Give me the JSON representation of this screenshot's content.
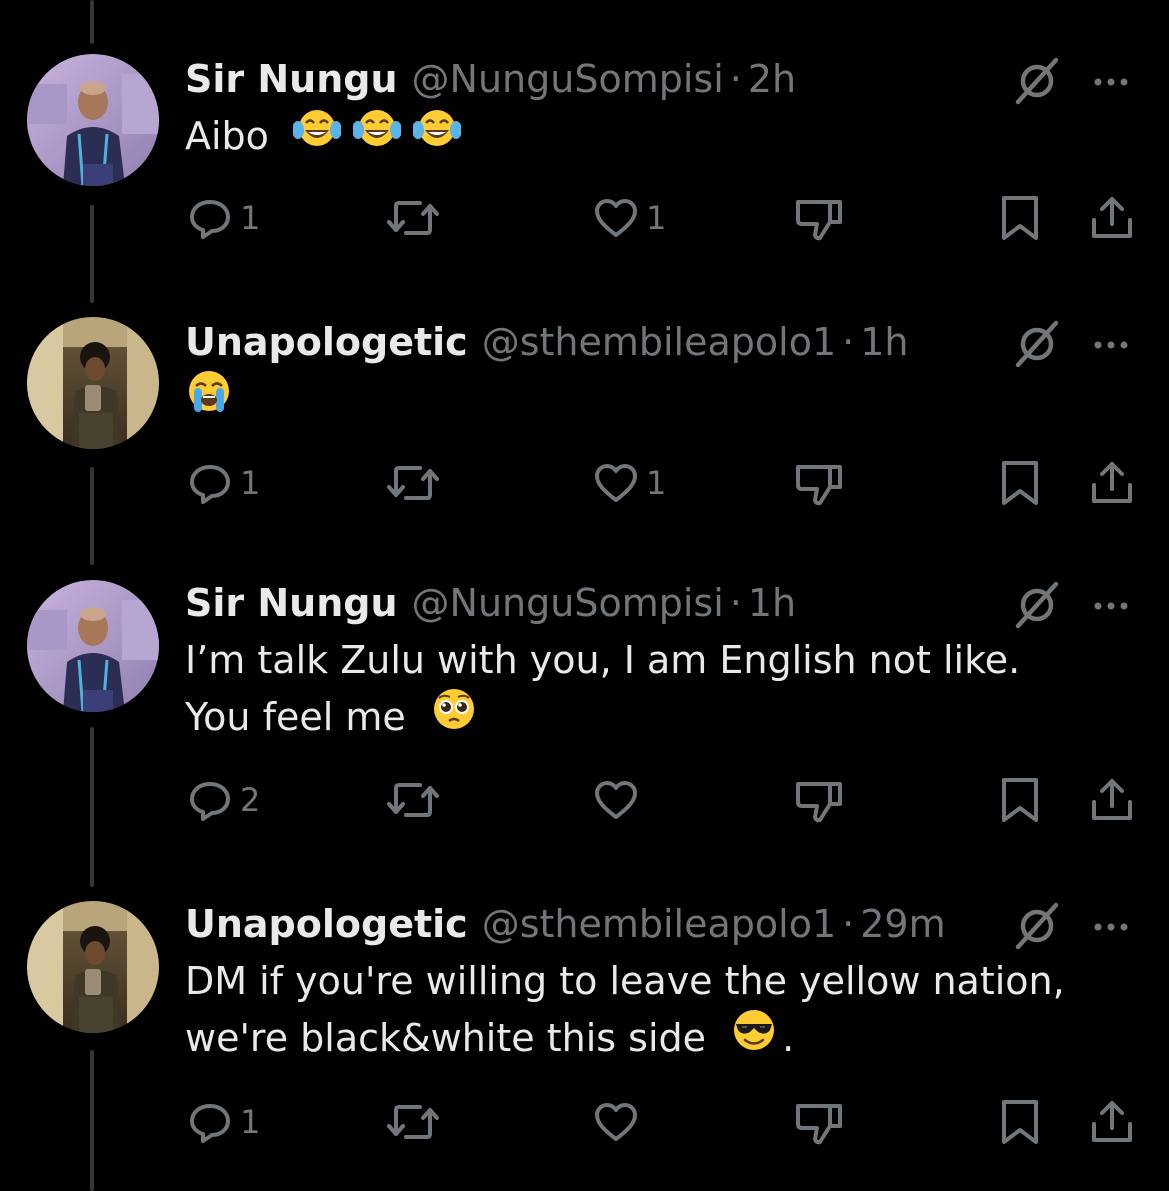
{
  "tweets": [
    {
      "name": "Sir Nungu",
      "handle": "@NunguSompisi",
      "separator": "·",
      "time": "2h",
      "lines": [
        "Aibo",
        ""
      ],
      "emojis": [
        "laughing-tears",
        "laughing-tears",
        "laughing-tears"
      ],
      "replies": "1",
      "reposts": "",
      "likes": "1"
    },
    {
      "name": "Unapologetic",
      "handle": "@sthembileapolo1",
      "separator": "·",
      "time": "1h",
      "lines": [
        "",
        ""
      ],
      "emojis": [
        "loudly-crying"
      ],
      "replies": "1",
      "reposts": "",
      "likes": "1"
    },
    {
      "name": "Sir Nungu",
      "handle": "@NunguSompisi",
      "separator": "·",
      "time": "1h",
      "lines": [
        "I’m talk Zulu with you, I am English not like.",
        "You feel me"
      ],
      "emojis": [
        "pleading-face"
      ],
      "replies": "2",
      "reposts": "",
      "likes": ""
    },
    {
      "name": "Unapologetic",
      "handle": "@sthembileapolo1",
      "separator": "·",
      "time": "29m",
      "lines": [
        "DM if you're willing to leave the yellow nation,",
        "we're black&white this side"
      ],
      "line2_suffix": ".",
      "emojis": [
        "sunglasses-face"
      ],
      "replies": "1",
      "reposts": "",
      "likes": ""
    }
  ],
  "icons": {
    "reply": "reply-icon",
    "repost": "repost-icon",
    "like": "heart-icon",
    "downvote": "downvote-icon",
    "bookmark": "bookmark-icon",
    "share": "share-icon",
    "grok": "grok-icon",
    "more": "more-icon"
  },
  "colors": {
    "background": "#000000",
    "text_primary": "#e7e9ea",
    "text_secondary": "#71767b",
    "thread_line": "#333639",
    "emoji": "#ffcc33"
  }
}
